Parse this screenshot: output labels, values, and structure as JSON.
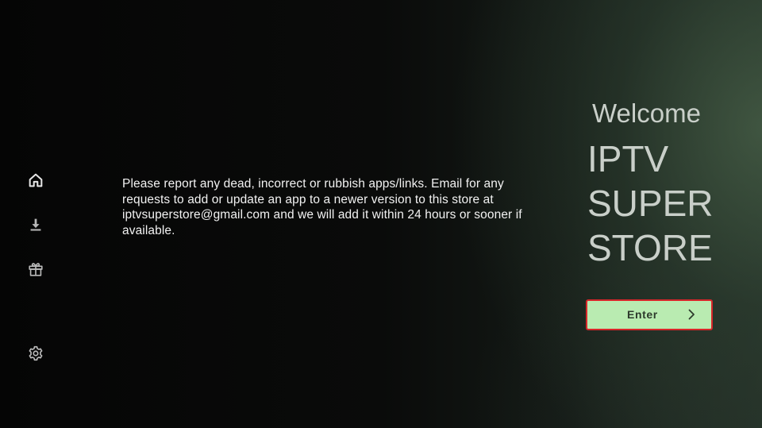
{
  "sidebar": {
    "items": [
      {
        "id": "home",
        "icon": "home-icon"
      },
      {
        "id": "downloads",
        "icon": "download-icon"
      },
      {
        "id": "gifts",
        "icon": "gift-icon"
      },
      {
        "id": "settings",
        "icon": "gear-icon"
      }
    ],
    "icon_color": "#e0e0e0"
  },
  "main": {
    "message": "Please report any dead, incorrect or rubbish apps/links. Email for any requests to add or update an app to a newer version to this store at iptvsuperstore@gmail.com and we will add it within 24 hours or sooner if available."
  },
  "hero": {
    "welcome": "Welcome",
    "title_lines": [
      "IPTV",
      "SUPER",
      "STORE"
    ]
  },
  "enter_button": {
    "label": "Enter",
    "icon": "chevron-right-icon",
    "background": "#b9ebb1",
    "border": "#d8262a"
  }
}
